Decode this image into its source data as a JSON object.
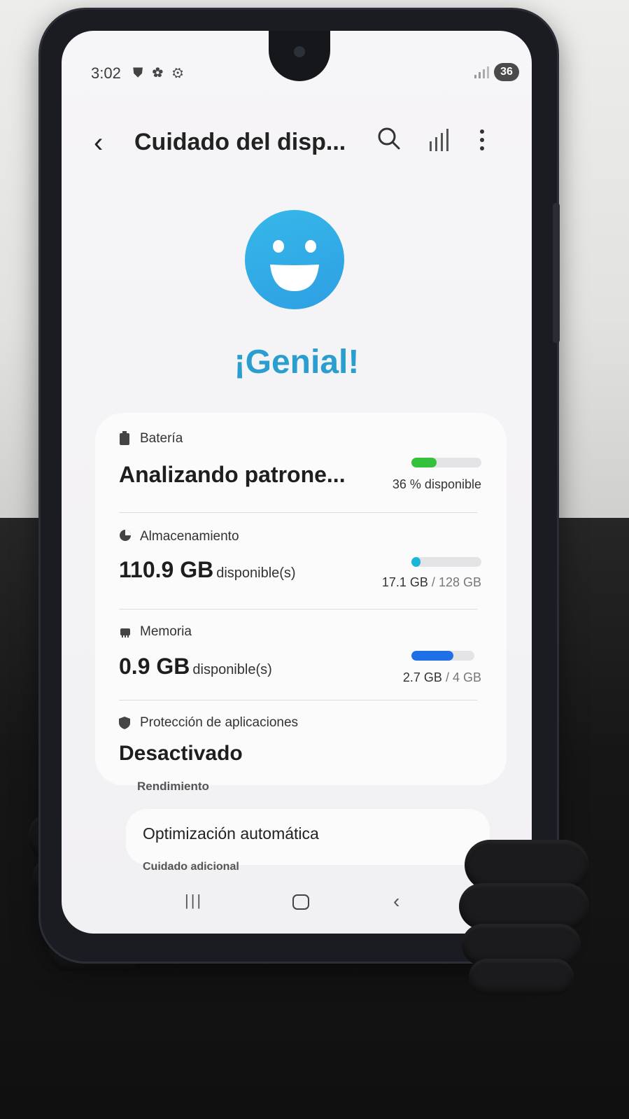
{
  "status_bar": {
    "time": "3:02",
    "notification_icons": "⛊ ✿ ⚙",
    "signal_icon": "signal-bars-icon",
    "battery_level": "36"
  },
  "header": {
    "back_glyph": "‹",
    "title": "Cuidado del disp..."
  },
  "status_message": "¡Genial!",
  "battery": {
    "label": "Batería",
    "value": "Analizando patrone...",
    "available_text": "36 % disponible",
    "level_fraction": 0.36,
    "bar_color": "#34c23c"
  },
  "storage": {
    "label": "Almacenamiento",
    "value": "110.9 GB",
    "unit": "disponible(s)",
    "used": "17.1 GB",
    "separator": "/",
    "total": "128 GB",
    "used_fraction": 0.13,
    "bar_color": "#19b6d8"
  },
  "memory": {
    "label": "Memoria",
    "value": "0.9 GB",
    "unit": "disponible(s)",
    "used": "2.7 GB",
    "separator": "/",
    "total": "4 GB",
    "used_fraction": 0.67,
    "bar_color": "#1f6fe6"
  },
  "app_protection": {
    "label": "Protección de aplicaciones",
    "value": "Desactivado"
  },
  "performance": {
    "section_label": "Rendimiento",
    "item": "Optimización automática"
  },
  "additional": {
    "section_label": "Cuidado adicional"
  },
  "nav": {
    "recent_glyph": "|||",
    "back_glyph": "‹"
  },
  "colors": {
    "accent": "#2b9ed0",
    "smiley": "#34b4e8"
  }
}
